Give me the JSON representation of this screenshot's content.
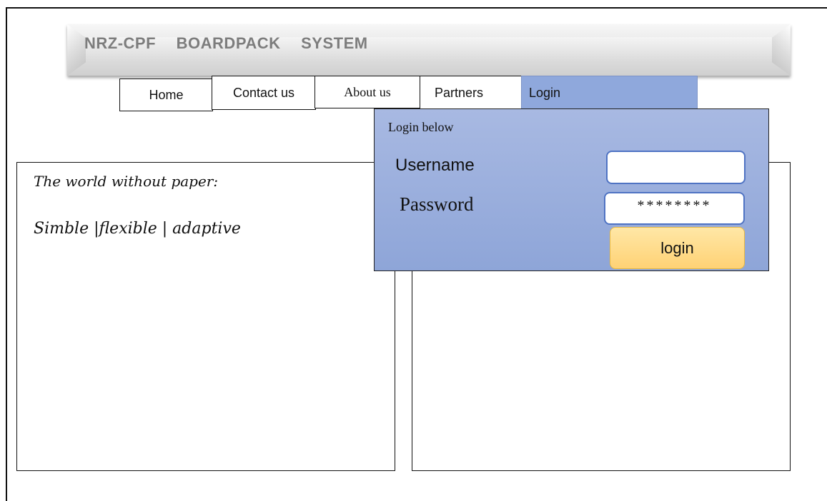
{
  "banner": {
    "title": "NRZ-CPF BOARDPACK SYSTEM"
  },
  "nav": {
    "home": "Home",
    "contact": "Contact us",
    "about": "About us",
    "partners": "Partners",
    "login": "Login"
  },
  "content": {
    "tagline_line1": "The world without paper:",
    "tagline_line2": "Simble |flexible | adaptive"
  },
  "login_panel": {
    "heading": "Login below",
    "username_label": "Username",
    "password_label": "Password",
    "username_value": "",
    "password_value": "********",
    "submit_label": "login"
  },
  "colors": {
    "login_panel_bg": "#8ea5d8",
    "login_button_bg": "#ffd275",
    "field_border": "#4f73c3"
  }
}
